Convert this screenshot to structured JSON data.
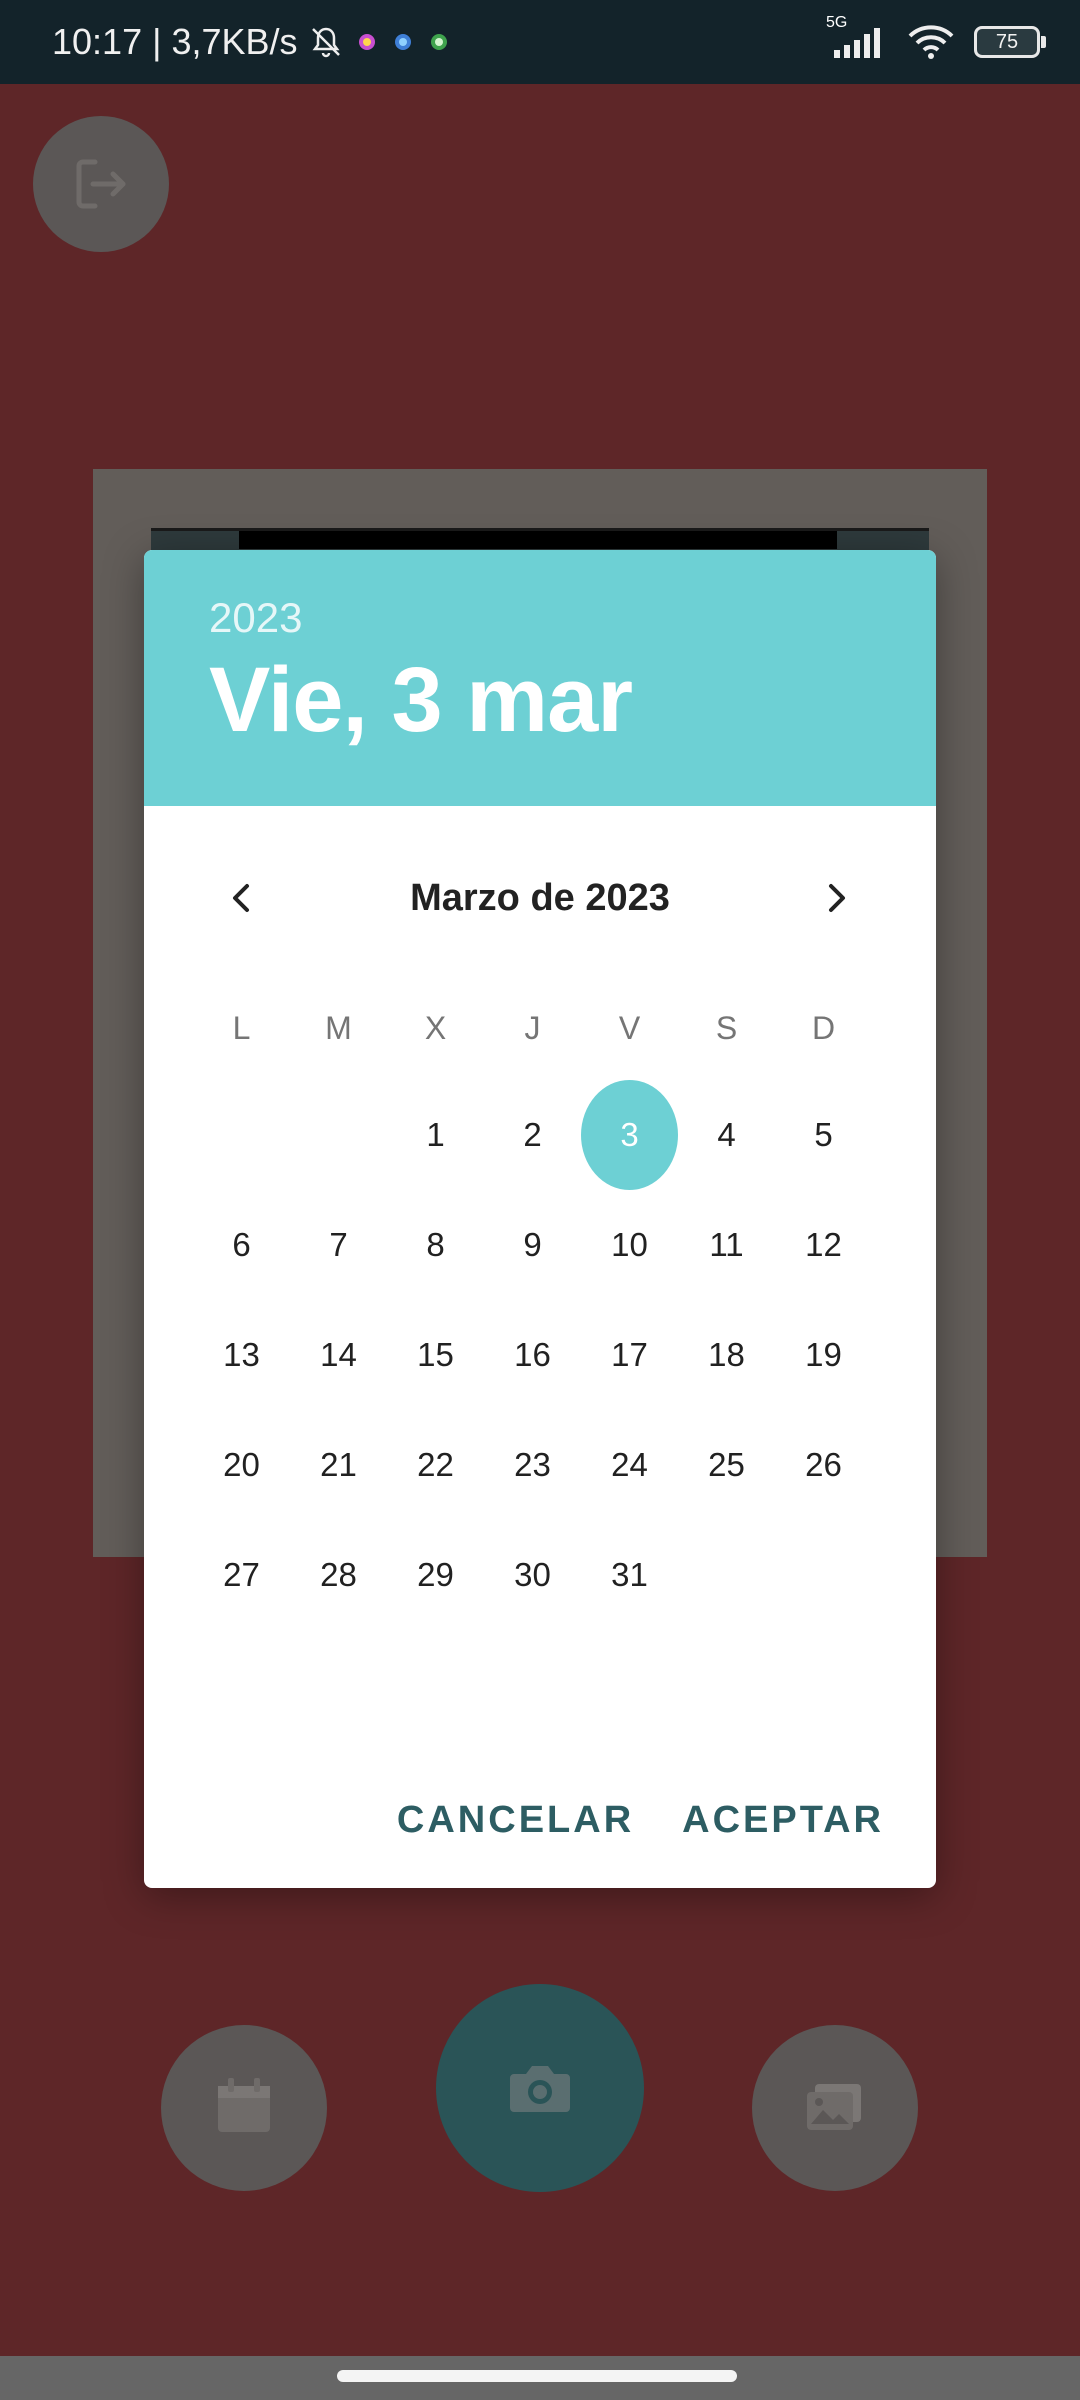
{
  "status_bar": {
    "time": "10:17",
    "separator": "|",
    "data_rate": "3,7KB/s",
    "network_type": "5G",
    "battery": "75"
  },
  "dialog": {
    "year": "2023",
    "selected_date": "Vie, 3 mar",
    "month_title": "Marzo de 2023",
    "weekdays": [
      "L",
      "M",
      "X",
      "J",
      "V",
      "S",
      "D"
    ],
    "days": [
      "",
      "",
      "1",
      "2",
      "3",
      "4",
      "5",
      "6",
      "7",
      "8",
      "9",
      "10",
      "11",
      "12",
      "13",
      "14",
      "15",
      "16",
      "17",
      "18",
      "19",
      "20",
      "21",
      "22",
      "23",
      "24",
      "25",
      "26",
      "27",
      "28",
      "29",
      "30",
      "31",
      "",
      ""
    ],
    "cancel_label": "CANCELAR",
    "accept_label": "ACEPTAR"
  },
  "colors": {
    "accent": "#6dd0d4",
    "background": "#5e2628",
    "action_text": "#2d5d63"
  }
}
